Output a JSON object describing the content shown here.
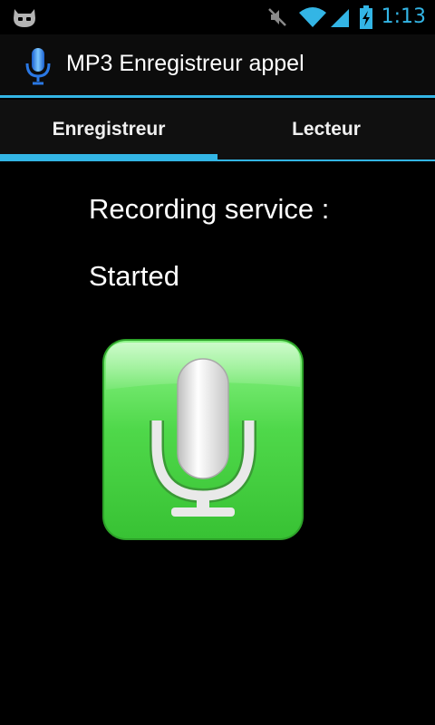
{
  "status_bar": {
    "time": "1:13",
    "icons": [
      "cyanogen-mascot-icon",
      "mute-icon",
      "wifi-icon",
      "cell-signal-icon",
      "battery-charging-icon"
    ],
    "accent": "#33b5e5"
  },
  "action_bar": {
    "title": "MP3 Enregistreur appel",
    "icon": "microphone-icon"
  },
  "tabs": [
    {
      "label": "Enregistreur",
      "selected": true
    },
    {
      "label": "Lecteur",
      "selected": false
    }
  ],
  "content": {
    "service_label": "Recording service :",
    "service_status": "Started",
    "record_button_icon": "microphone-icon",
    "record_button_color": "#4cd64a"
  }
}
